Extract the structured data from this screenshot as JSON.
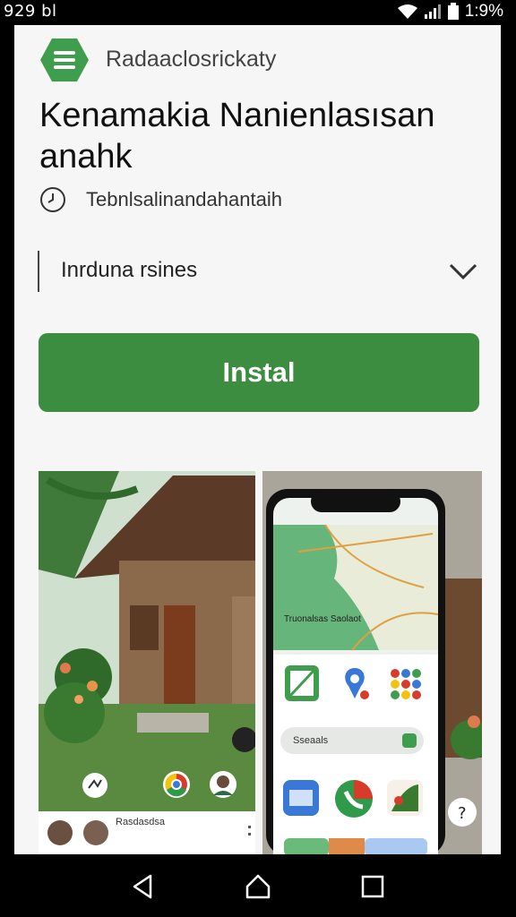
{
  "status_bar": {
    "time": "929 bl",
    "battery_text": "1:9%",
    "icons": [
      "wifi-icon",
      "signal-icon",
      "battery-icon"
    ]
  },
  "app": {
    "developer_label": "Radaaclosrickaty",
    "title": "Kenamakia Nanienlasısan anahk",
    "subtitle": "Tebnlsalinandahantaih",
    "dropdown_value": "Inrduna rsines",
    "install_label": "Instal",
    "logo_icon": "menu-icon",
    "logo_color": "#3f9d4e",
    "accent_color": "#3c8d40"
  },
  "screenshots": {
    "first": {
      "caption": "Rasdasdsa",
      "icons": [
        "share-icon",
        "chrome-icon",
        "avatar"
      ]
    },
    "second": {
      "map_label": "Truonalsas Saolaot",
      "search_label": "Sseaals",
      "icons": [
        "gallery-icon",
        "maps-icon",
        "apps-icon",
        "files-icon",
        "phone-icon",
        "photos-icon"
      ]
    }
  },
  "nav": {
    "buttons": [
      "back-icon",
      "home-icon",
      "recents-icon"
    ]
  }
}
